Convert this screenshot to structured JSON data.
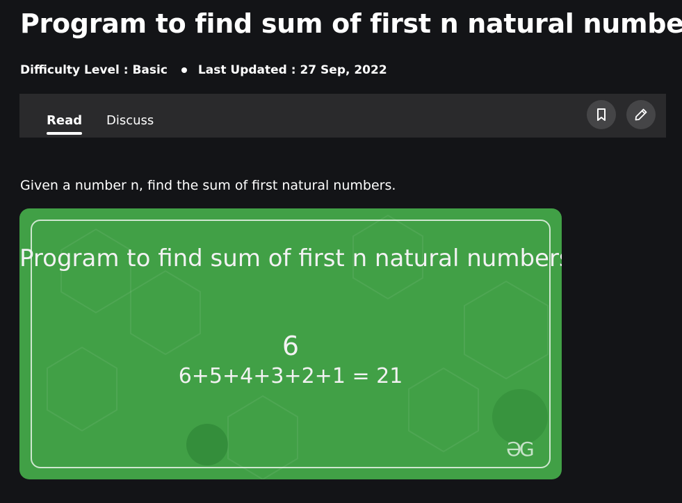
{
  "article": {
    "title": "Program to find sum of first n natural numbers",
    "difficulty": "Difficulty Level : Basic",
    "last_updated": "Last Updated : 27 Sep, 2022",
    "intro": "Given a number n, find the sum of first natural numbers."
  },
  "tabs": [
    {
      "label": "Read",
      "active": true
    },
    {
      "label": "Discuss",
      "active": false
    }
  ],
  "actions": {
    "bookmark_icon": "bookmark-icon",
    "edit_icon": "pencil-icon"
  },
  "banner": {
    "title": "Program to find sum of first n natural numbers",
    "number": "6",
    "equation": "6+5+4+3+2+1 = 21",
    "logo": "ƏG",
    "background_color": "#41a046"
  }
}
